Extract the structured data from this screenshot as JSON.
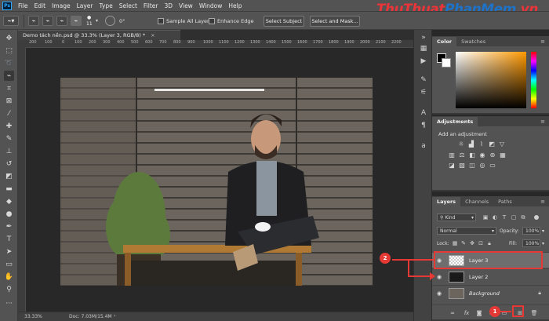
{
  "menu": {
    "logo": "Ps",
    "items": [
      "File",
      "Edit",
      "Image",
      "Layer",
      "Type",
      "Select",
      "Filter",
      "3D",
      "View",
      "Window",
      "Help"
    ]
  },
  "watermark": {
    "part1": "Thu",
    "part2": "Thuat",
    "part3": "Phan",
    "part4": "Mem",
    "part5": ".vn"
  },
  "options": {
    "brush_size": "11",
    "angle": "0°",
    "sample_all_layers": "Sample All Layers",
    "enhance_edge": "Enhance Edge",
    "select_subject": "Select Subject",
    "select_and_mask": "Select and Mask..."
  },
  "document": {
    "tab_title": "Demo tách nền.psd @ 33.3% (Layer 3, RGB/8) *",
    "close": "×",
    "ruler_marks": [
      "200",
      "100",
      "0",
      "100",
      "200",
      "300",
      "400",
      "500",
      "600",
      "700",
      "800",
      "900",
      "1000",
      "1100",
      "1200",
      "1300",
      "1400",
      "1500",
      "1600",
      "1700",
      "1800",
      "1900",
      "2000",
      "2100",
      "2200"
    ]
  },
  "status": {
    "zoom": "33.33%",
    "doc": "Doc: 7.03M/15.4M"
  },
  "color_panel": {
    "tabs": [
      "Color",
      "Swatches"
    ]
  },
  "adjustments": {
    "title": "Adjustments",
    "add": "Add an adjustment"
  },
  "layers": {
    "tabs": [
      "Layers",
      "Channels",
      "Paths"
    ],
    "kind": "Kind",
    "blend_mode": "Normal",
    "opacity_label": "Opacity:",
    "opacity_value": "100%",
    "lock_label": "Lock:",
    "fill_label": "Fill:",
    "fill_value": "100%",
    "items": [
      {
        "name": "Layer 3"
      },
      {
        "name": "Layer 2"
      },
      {
        "name": "Background"
      }
    ]
  },
  "annotations": {
    "step1": "1",
    "step2": "2"
  },
  "colors": {
    "accent_red": "#e53935",
    "panel_bg": "#535353",
    "canvas_bg": "#282828"
  }
}
